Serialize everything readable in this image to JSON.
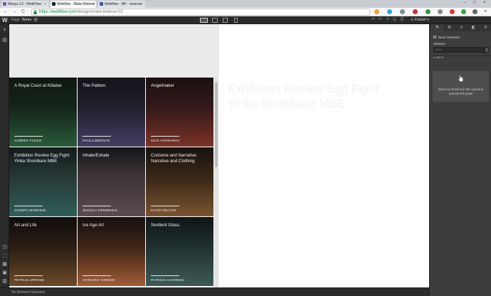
{
  "browser": {
    "tabs": [
      {
        "title": "Wasys 13 - WebFlow",
        "active": false,
        "favicon_color": "#7a5ca8"
      },
      {
        "title": "Webflow - Make Believe",
        "active": true,
        "favicon_color": "#222222"
      },
      {
        "title": "Webflow - MF - testcuis",
        "active": false,
        "favicon_color": "#3a5a9a"
      }
    ],
    "window_controls": [
      "–",
      "□",
      "×"
    ],
    "url_host": "https://webflow.com",
    "url_path": "/design/make-believe-02",
    "nav": {
      "back": "←",
      "forward": "→",
      "reload": "C"
    },
    "extension_colors": [
      "#e8a33a",
      "#3aa4d8",
      "#7a8d99",
      "#c33",
      "#3b8f4a",
      "#888",
      "#3aa44a",
      "#666"
    ]
  },
  "webflow": {
    "logo": "W",
    "page_label": "Page",
    "page_name": "Home",
    "publish_label": "Publish",
    "right_icons": [
      "↶",
      "↷",
      "●",
      "⟨⟩",
      "{}",
      "⚑"
    ],
    "left_tools": [
      "+",
      "▤",
      "⬚",
      "⬚",
      "◳",
      "⬚",
      "⬚",
      "⇩",
      "?"
    ]
  },
  "canvas": {
    "ghost_heading": "Exhibition Review Egg Fight: Yinka Shonibare MBE",
    "cards": [
      {
        "title": "A Royal Court at Killaloe",
        "author": "AUBREY FLEGG",
        "bg": "linear-gradient(180deg,#0f1611 0%,#15261b 45%,#2a5a3a 100%)"
      },
      {
        "title": "The Pattern",
        "author": "PAULA MEEHAN",
        "bg": "linear-gradient(180deg,#141319 0%,#22202f 45%,#463d63 100%)"
      },
      {
        "title": "Angelmaker",
        "author": "NICK HARKAWAY",
        "bg": "linear-gradient(180deg,#191010 0%,#35191a 45%,#7a3227 100%)"
      },
      {
        "title": "Exhibition Review Egg Fight: Yinka Shonibare MBE",
        "author": "JOSEPH MCBRINN",
        "bg": "linear-gradient(180deg,#141a19 0%,#273a37 45%,#2f5e58 100%)"
      },
      {
        "title": "Inhale/Exhale",
        "author": "JESSICA HEMMINGS",
        "bg": "linear-gradient(180deg,#161419 0%,#3a3438 40%,#5c4a52 100%)"
      },
      {
        "title": "Costume and Narrative: Narrative and Clothing",
        "author": "DAVID WILCOX",
        "bg": "linear-gradient(180deg,#17120e 0%,#3a2818 45%,#7a5330 100%)"
      },
      {
        "title": "Art and Life",
        "author": "PETRUS SPRONK",
        "bg": "linear-gradient(180deg,#0f0d0c 0%,#2c1e14 45%,#6b4a2a 100%)"
      },
      {
        "title": "Ice Age Art",
        "author": "ANTHONY O'BRIEN",
        "bg": "linear-gradient(180deg,#14100e 0%,#402617 45%,#a05b36 100%)"
      },
      {
        "title": "Sentient Glass",
        "author": "PATRICK CHAPMAN",
        "bg": "linear-gradient(180deg,#111414 0%,#213232 45%,#3d5a55 100%)"
      }
    ]
  },
  "status_bar": {
    "text": "No Element Selected"
  },
  "right_panel": {
    "tabs": [
      "✎",
      "⚙",
      "≡",
      "◧",
      "⚲"
    ],
    "none_selected_label": "None Selected",
    "selector_label": "Selector",
    "selector_placeholder": "None",
    "none_tag": "None",
    "canvas_hint": "Select an element in the canvas to activate this panel"
  }
}
